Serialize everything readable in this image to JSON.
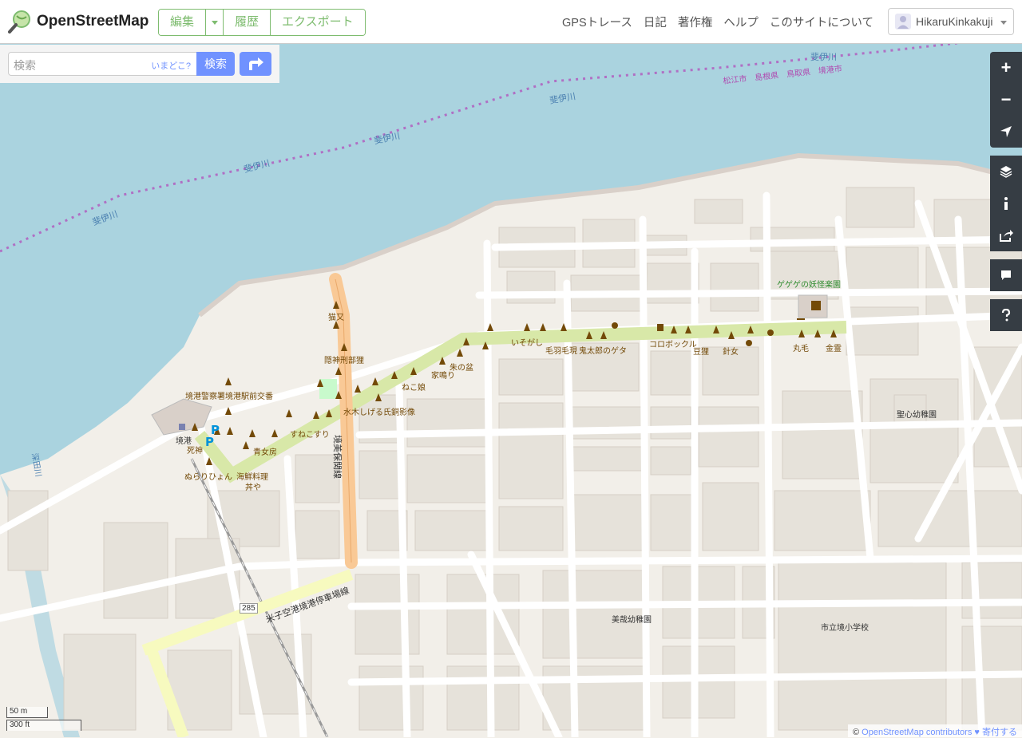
{
  "app": {
    "name": "OpenStreetMap"
  },
  "header": {
    "edit_label": "編集",
    "history_label": "履歴",
    "export_label": "エクスポート",
    "nav": [
      "GPSトレース",
      "日記",
      "著作権",
      "ヘルプ",
      "このサイトについて"
    ],
    "username": "HikaruKinkakuji"
  },
  "search": {
    "placeholder": "検索",
    "where_am_i": "いまどこ?",
    "button_label": "検索"
  },
  "map": {
    "labels": {
      "river": "斐伊川",
      "river2": "深田川",
      "boundary": "松江市　島根県　鳥取県　境港市",
      "park": "ゲゲゲの妖怪楽園",
      "kindergarten1": "聖心幼稚園",
      "kindergarten2": "美哉幼稚園",
      "school": "市立境小学校",
      "police": "境港警察署境港駅前交番",
      "station": "境港",
      "shinigami": "死神",
      "road1": "境美保関線",
      "road2": "米子空港境港停車場線",
      "route": "285",
      "statue": "水木しげる氏銅影像",
      "nekomata": "猫又",
      "okibe": "隠神刑部狸",
      "nekomusume": "ねこ娘",
      "yanari": "家鳴り",
      "shunobon": "朱の盆",
      "iso": "いそがし",
      "kerakera": "毛羽毛現",
      "kitaro": "鬼太郎のゲタ",
      "korobo": "コロボックル",
      "mame": "豆狸",
      "hari": "針女",
      "maru": "丸毛",
      "kinrei": "金霊",
      "sunekosuri": "すねこすり",
      "aonyobo": "青女房",
      "nurari": "ぬらりひょん",
      "seafood": "海鮮料理",
      "donya": "丼や"
    },
    "scale_m": "50 m",
    "scale_ft": "300 ft",
    "attribution_prefix": "©",
    "attribution_link": "OpenStreetMap contributors",
    "donate": "♥ 寄付する"
  },
  "controls": [
    "zoom-in",
    "zoom-out",
    "locate",
    "layers",
    "info",
    "share",
    "note",
    "query"
  ],
  "colors": {
    "accent": "#7ebc6f",
    "search": "#7092ff",
    "water": "#aad3df",
    "land": "#f2efe9",
    "control": "#363d44"
  }
}
